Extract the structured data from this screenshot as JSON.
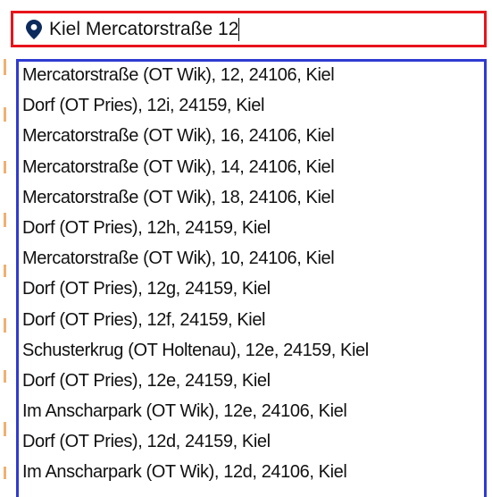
{
  "search": {
    "value": "Kiel Mercatorstraße 12",
    "icon": "map-pin-icon",
    "border_color": "#e8141b",
    "icon_color": "#0d2a5c"
  },
  "dropdown": {
    "border_color": "#2f3bd1",
    "options": [
      "Mercatorstraße (OT Wik), 12, 24106, Kiel",
      "Dorf (OT Pries), 12i, 24159, Kiel",
      "Mercatorstraße (OT Wik), 16, 24106, Kiel",
      "Mercatorstraße (OT Wik), 14, 24106, Kiel",
      "Mercatorstraße (OT Wik), 18, 24106, Kiel",
      "Dorf (OT Pries), 12h, 24159, Kiel",
      "Mercatorstraße (OT Wik), 10, 24106, Kiel",
      "Dorf (OT Pries), 12g, 24159, Kiel",
      "Dorf (OT Pries), 12f, 24159, Kiel",
      "Schusterkrug (OT Holtenau), 12e, 24159, Kiel",
      "Dorf (OT Pries), 12e, 24159, Kiel",
      "Im Anscharpark (OT Wik), 12e, 24106, Kiel",
      "Dorf (OT Pries), 12d, 24159, Kiel",
      "Im Anscharpark (OT Wik), 12d, 24106, Kiel"
    ]
  }
}
